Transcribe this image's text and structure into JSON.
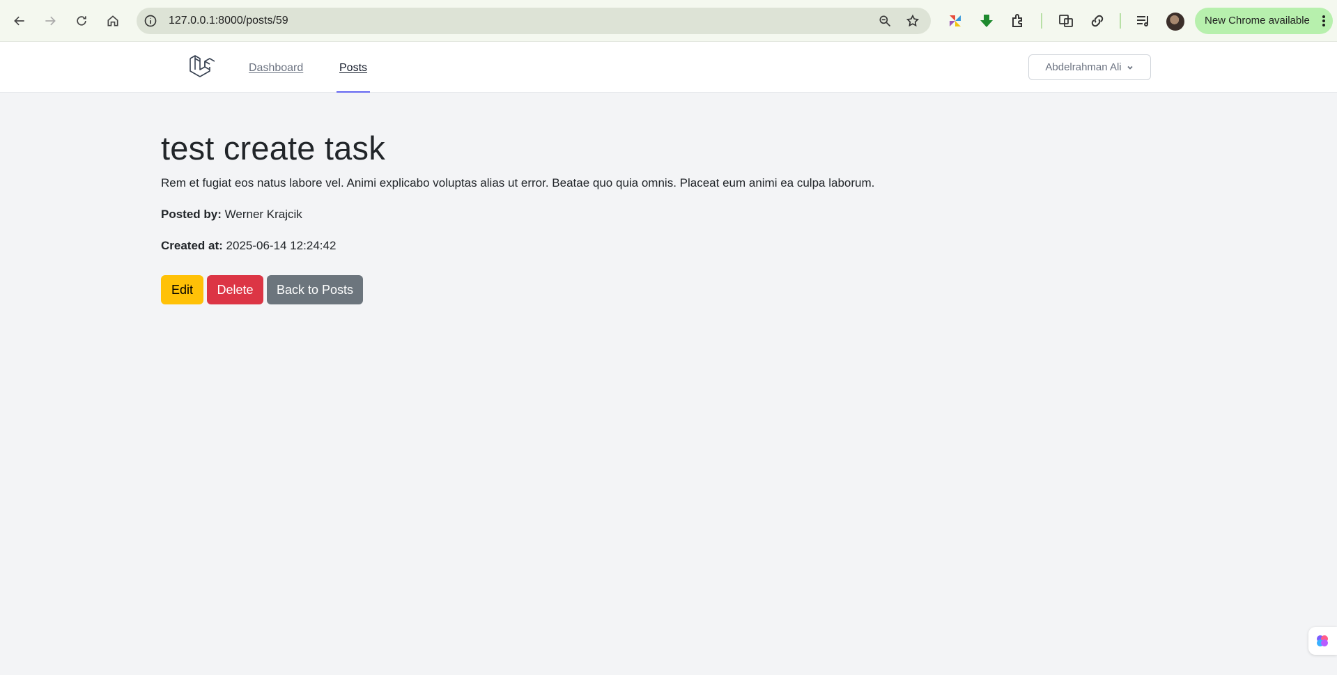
{
  "browser": {
    "url": "127.0.0.1:8000/posts/59",
    "update_label": "New Chrome available"
  },
  "nav": {
    "links": [
      {
        "label": "Dashboard",
        "active": false
      },
      {
        "label": "Posts",
        "active": true
      }
    ],
    "user_name": "Abdelrahman Ali"
  },
  "post": {
    "title": "test create task",
    "body": "Rem et fugiat eos natus labore vel. Animi explicabo voluptas alias ut error. Beatae quo quia omnis. Placeat eum animi ea culpa laborum.",
    "posted_by_label": "Posted by:",
    "posted_by": "Werner Krajcik",
    "created_at_label": "Created at:",
    "created_at": "2025-06-14 12:24:42"
  },
  "actions": {
    "edit": "Edit",
    "delete": "Delete",
    "back": "Back to Posts"
  },
  "colors": {
    "edit": "#ffc107",
    "delete": "#dc3545",
    "back": "#6c757d",
    "active_nav": "#6366f1",
    "page_bg": "#f3f4f6"
  }
}
